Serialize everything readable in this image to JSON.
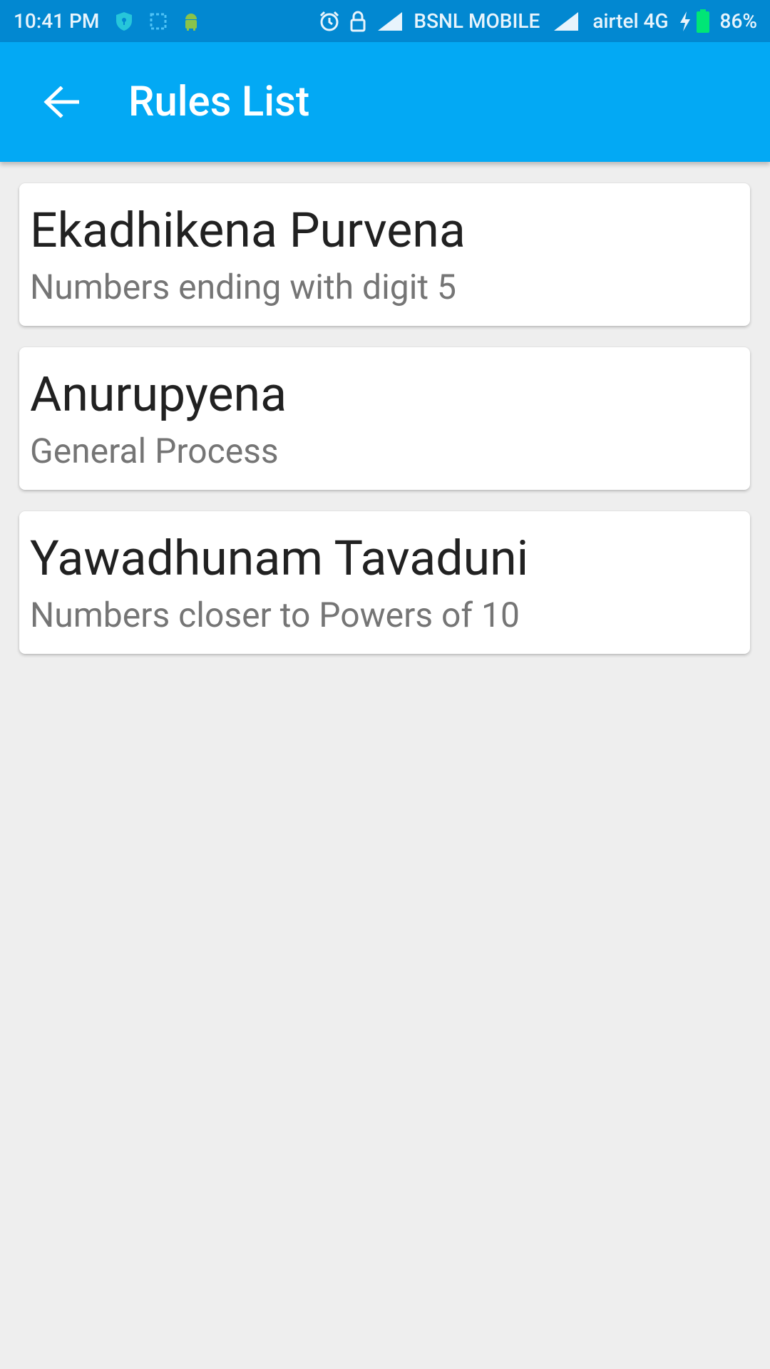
{
  "status_bar": {
    "time": "10:41 PM",
    "carrier1": "BSNL MOBILE",
    "carrier2": "airtel 4G",
    "battery": "86%",
    "icons": [
      "shield-icon",
      "screenshot-icon",
      "android-icon",
      "alarm-icon",
      "lock-icon",
      "signal-icon",
      "signal-icon",
      "charging-icon",
      "battery-icon"
    ]
  },
  "app_bar": {
    "title": "Rules List",
    "back_icon": "arrow-left-icon"
  },
  "rules": [
    {
      "title": "Ekadhikena Purvena",
      "subtitle": "Numbers ending with digit 5"
    },
    {
      "title": "Anurupyena",
      "subtitle": "General Process"
    },
    {
      "title": "Yawadhunam Tavaduni",
      "subtitle": "Numbers closer to Powers of 10"
    }
  ],
  "colors": {
    "status_bar": "#0288d1",
    "app_bar": "#03a9f4",
    "background": "#eeeeee",
    "card": "#ffffff",
    "title_text": "#212121",
    "subtitle_text": "#757575"
  }
}
